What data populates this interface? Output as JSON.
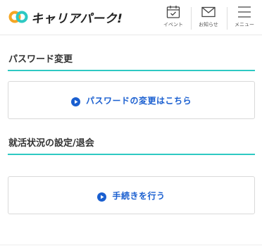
{
  "header": {
    "logo_text": "キャリアパーク!",
    "nav": [
      {
        "label": "イベント",
        "icon": "calendar-icon"
      },
      {
        "label": "お知らせ",
        "icon": "mail-icon"
      },
      {
        "label": "メニュー",
        "icon": "menu-icon"
      }
    ]
  },
  "sections": [
    {
      "title": "パスワード変更",
      "link_label": "パスワードの変更はこちら",
      "link_icon": "play-circle-icon"
    },
    {
      "title": "就活状況の設定/退会",
      "link_label": "手続きを行う",
      "link_icon": "play-circle-icon"
    }
  ],
  "colors": {
    "accent_teal": "#2ec9c3",
    "link_blue": "#1a5fd0",
    "logo_orange": "#f5a623",
    "logo_teal": "#2ec9c3"
  }
}
